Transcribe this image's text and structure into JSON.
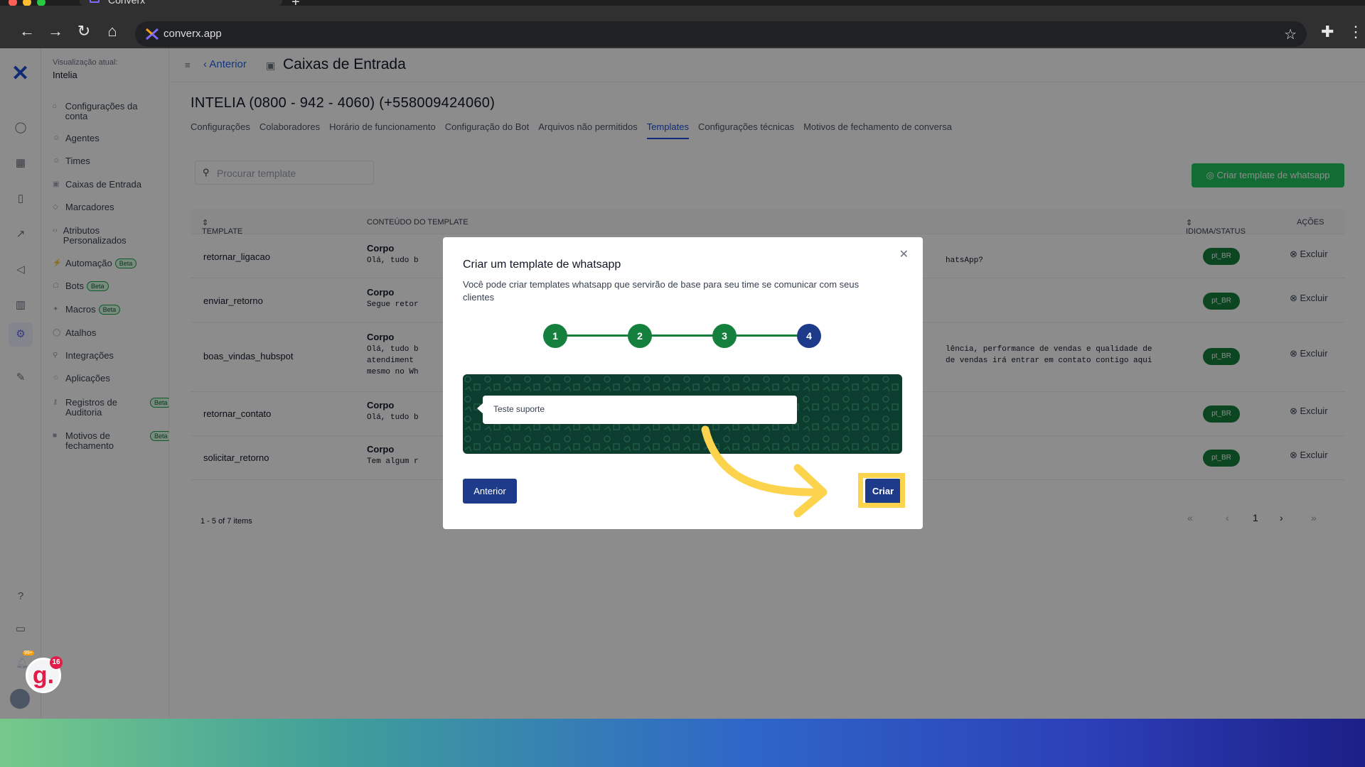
{
  "browser": {
    "tab_title": "Converx",
    "url": "converx.app"
  },
  "sidebar": {
    "view_label": "Visualização atual:",
    "view_value": "Intelia",
    "items": [
      {
        "label": "Configurações da conta"
      },
      {
        "label": "Agentes"
      },
      {
        "label": "Times"
      },
      {
        "label": "Caixas de Entrada"
      },
      {
        "label": "Marcadores"
      },
      {
        "label": "Atributos Personalizados"
      },
      {
        "label": "Automação",
        "badge": "Beta"
      },
      {
        "label": "Bots",
        "badge": "Beta"
      },
      {
        "label": "Macros",
        "badge": "Beta"
      },
      {
        "label": "Atalhos"
      },
      {
        "label": "Integrações"
      },
      {
        "label": "Aplicações"
      },
      {
        "label": "Registros de Auditoria",
        "badge": "Beta"
      },
      {
        "label": "Motivos de fechamento",
        "badge": "Beta"
      }
    ]
  },
  "topbar": {
    "back_label": "Anterior",
    "title": "Caixas de Entrada"
  },
  "inbox": {
    "heading": "INTELIA (0800 - 942 - 4060) (+558009424060)",
    "tabs": [
      "Configurações",
      "Colaboradores",
      "Horário de funcionamento",
      "Configuração do Bot",
      "Arquivos não permitidos",
      "Templates",
      "Configurações técnicas",
      "Motivos de fechamento de conversa"
    ],
    "active_tab": "Templates",
    "search_placeholder": "Procurar template",
    "create_button": "Criar template de whatsapp"
  },
  "table": {
    "columns": [
      "TEMPLATE",
      "CONTEÚDO DO TEMPLATE",
      "IDIOMA/STATUS",
      "AÇÕES"
    ],
    "rows": [
      {
        "name": "retornar_ligacao",
        "section": "Corpo",
        "body": "Olá, tudo b",
        "body_right": "hatsApp?",
        "lang": "pt_BR",
        "action": "Excluir"
      },
      {
        "name": "enviar_retorno",
        "section": "Corpo",
        "body": "Segue retor",
        "body_right": "",
        "lang": "pt_BR",
        "action": "Excluir"
      },
      {
        "name": "boas_vindas_hubspot",
        "section": "Corpo",
        "body": "Olá, tudo b\natendiment\nmesmo no Wh",
        "body_right": "lência, performance de vendas e qualidade de\nde vendas irá entrar em contato contigo aqui",
        "lang": "pt_BR",
        "action": "Excluir"
      },
      {
        "name": "retornar_contato",
        "section": "Corpo",
        "body": "Olá, tudo b",
        "body_right": "",
        "lang": "pt_BR",
        "action": "Excluir"
      },
      {
        "name": "solicitar_retorno",
        "section": "Corpo",
        "body": "Tem algum r",
        "body_right": "",
        "lang": "pt_BR",
        "action": "Excluir"
      }
    ],
    "pagination_info": "1 - 5 of 7 items",
    "current_page": "1"
  },
  "modal": {
    "title": "Criar um template de whatsapp",
    "description": "Você pode criar templates whatsapp que servirão de base para seu time se comunicar com seus clientes",
    "steps": [
      "1",
      "2",
      "3",
      "4"
    ],
    "current_step": 4,
    "preview_text": "Teste suporte",
    "prev_button": "Anterior",
    "create_button": "Criar"
  },
  "notifications": {
    "g_count": "16",
    "bell_badge": "99+"
  },
  "colors": {
    "primary": "#1e3a8a",
    "success": "#15803d",
    "highlight": "#fbd34d"
  }
}
